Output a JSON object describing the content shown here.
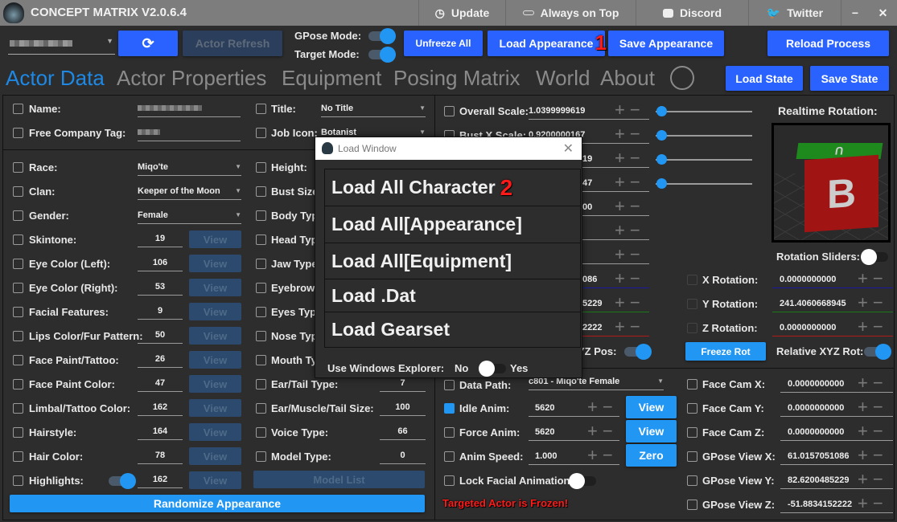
{
  "app": {
    "title": "CONCEPT MATRIX V2.0.6.4",
    "titlebar_buttons": [
      {
        "label": "Update",
        "icon": "history-icon"
      },
      {
        "label": "Always on Top",
        "icon": "pin-icon"
      },
      {
        "label": "Discord",
        "icon": "discord-icon"
      },
      {
        "label": "Twitter",
        "icon": "twitter-icon"
      }
    ]
  },
  "toolbar": {
    "actor_select": "",
    "actor_refresh": "Actor Refresh",
    "gpose_mode": "GPose Mode:",
    "target_mode": "Target Mode:",
    "unfreeze_all": "Unfreeze All",
    "load_appearance": "Load Appearance",
    "save_appearance": "Save Appearance",
    "reload_process": "Reload Process",
    "load_state": "Load State",
    "save_state": "Save State",
    "annotation1": "1"
  },
  "tabs": [
    "Actor Data",
    "Actor Properties",
    "Equipment",
    "Posing Matrix",
    "World",
    "About"
  ],
  "actor": {
    "name_label": "Name:",
    "fc_label": "Free Company Tag:",
    "title_label": "Title:",
    "title_value": "No Title",
    "job_label": "Job Icon:",
    "job_value": "Botanist"
  },
  "left_rows": [
    {
      "label": "Race:",
      "value": "Miqo'te",
      "type": "select"
    },
    {
      "label": "Clan:",
      "value": "Keeper of the Moon",
      "type": "select"
    },
    {
      "label": "Gender:",
      "value": "Female",
      "type": "select"
    },
    {
      "label": "Skintone:",
      "value": "19",
      "type": "view"
    },
    {
      "label": "Eye Color (Left):",
      "value": "106",
      "type": "view"
    },
    {
      "label": "Eye Color (Right):",
      "value": "53",
      "type": "view"
    },
    {
      "label": "Facial Features:",
      "value": "9",
      "type": "view"
    },
    {
      "label": "Lips Color/Fur Pattern:",
      "value": "50",
      "type": "view"
    },
    {
      "label": "Face Paint/Tattoo:",
      "value": "26",
      "type": "view"
    },
    {
      "label": "Face Paint Color:",
      "value": "47",
      "type": "view"
    },
    {
      "label": "Limbal/Tattoo Color:",
      "value": "162",
      "type": "view"
    },
    {
      "label": "Hairstyle:",
      "value": "164",
      "type": "view"
    },
    {
      "label": "Hair Color:",
      "value": "78",
      "type": "view"
    },
    {
      "label": "Highlights:",
      "value": "162",
      "type": "view"
    }
  ],
  "view_label": "View",
  "randomize": "Randomize Appearance",
  "col2_rows": [
    {
      "label": "Height:",
      "value": ""
    },
    {
      "label": "Bust Size",
      "value": ""
    },
    {
      "label": "Body Typ",
      "value": ""
    },
    {
      "label": "Head Typ",
      "value": ""
    },
    {
      "label": "Jaw Type",
      "value": ""
    },
    {
      "label": "Eyebrows",
      "value": ""
    },
    {
      "label": "Eyes Type",
      "value": ""
    },
    {
      "label": "Nose Typ",
      "value": ""
    },
    {
      "label": "Mouth Ty",
      "value": ""
    },
    {
      "label": "Ear/Tail Type:",
      "value": "7"
    },
    {
      "label": "Ear/Muscle/Tail Size:",
      "value": "100"
    },
    {
      "label": "Voice Type:",
      "value": "66"
    },
    {
      "label": "Model Type:",
      "value": "0"
    }
  ],
  "model_list": "Model List",
  "scale_rows": [
    {
      "label": "Overall Scale:",
      "value": "1.0399999619"
    },
    {
      "label": "Bust X Scale:",
      "value": "0.9200000167"
    },
    {
      "label": "",
      "value": "19"
    },
    {
      "label": "",
      "value": "47"
    },
    {
      "label": "",
      "value": "00"
    },
    {
      "label": "",
      "value": ""
    },
    {
      "label": "",
      "value": ""
    },
    {
      "label": "",
      "value": "086"
    },
    {
      "label": "",
      "value": "5229"
    },
    {
      "label": "",
      "value": "2222"
    }
  ],
  "rel_pos": "YZ Pos:",
  "anim": {
    "data_path_label": "Data Path:",
    "data_path_value": "c801 - Miqo'te Female",
    "idle_label": "Idle Anim:",
    "idle_value": "5620",
    "force_label": "Force Anim:",
    "force_value": "5620",
    "speed_label": "Anim Speed:",
    "speed_value": "1.000",
    "view": "View",
    "zero": "Zero",
    "lock_label": "Lock Facial Animation:",
    "frozen": "Targeted Actor is Frozen!"
  },
  "rotation": {
    "header": "Realtime Rotation:",
    "sliders_label": "Rotation Sliders:",
    "cube_letter_front": "B",
    "cube_letter_top": "U",
    "rows": [
      {
        "label": "X Rotation:",
        "value": "0.0000000000",
        "color": "#1a1aa0"
      },
      {
        "label": "Y Rotation:",
        "value": "241.4060668945",
        "color": "#1a7a1a"
      },
      {
        "label": "Z Rotation:",
        "value": "0.0000000000",
        "color": "#b01a1a"
      }
    ],
    "freeze_rot": "Freeze Rot",
    "relative_rot": "Relative XYZ Rot:"
  },
  "cam_rows": [
    {
      "label": "Face Cam X:",
      "value": "0.0000000000"
    },
    {
      "label": "Face Cam Y:",
      "value": "0.0000000000"
    },
    {
      "label": "Face Cam Z:",
      "value": "0.0000000000"
    },
    {
      "label": "GPose View X:",
      "value": "61.0157051086"
    },
    {
      "label": "GPose View Y:",
      "value": "82.6200485229"
    },
    {
      "label": "GPose View Z:",
      "value": "-51.8834152222"
    }
  ],
  "modal": {
    "title": "Load Window",
    "buttons": [
      "Load All Character",
      "Load All[Appearance]",
      "Load All[Equipment]",
      "Load .Dat",
      "Load Gearset"
    ],
    "annotation2": "2",
    "explorer_label": "Use Windows Explorer:",
    "no": "No",
    "yes": "Yes"
  },
  "colors": {
    "accent": "#2196f3",
    "royal": "#2962ff",
    "frozen": "#ff1a1a"
  }
}
